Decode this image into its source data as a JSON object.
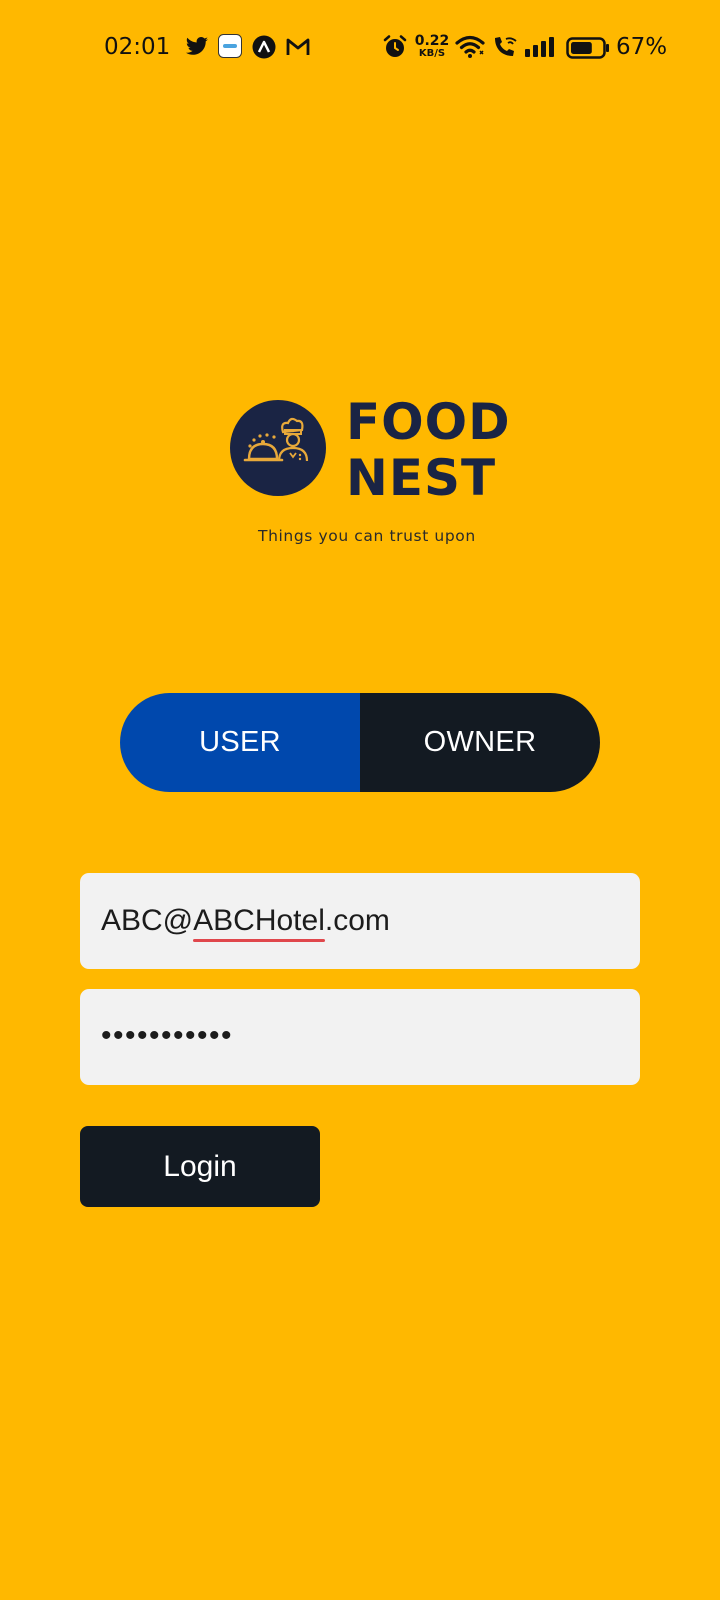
{
  "status_bar": {
    "time": "02:01",
    "net_speed_value": "0.22",
    "net_speed_unit": "KB/S",
    "battery_percent": "67%",
    "battery_level": 0.67,
    "icons": [
      "twitter-icon",
      "app-icon",
      "arc-icon",
      "gmail-icon",
      "alarm-icon",
      "wifi-icon",
      "wifi-call-icon",
      "signal-icon",
      "battery-icon"
    ]
  },
  "logo": {
    "line1": "FOOD",
    "line2": "NEST",
    "tagline": "Things you can trust upon",
    "brand_color": "#1a2444"
  },
  "role_toggle": {
    "options": [
      {
        "label": "USER",
        "selected": true
      },
      {
        "label": "OWNER",
        "selected": false
      }
    ],
    "selected_color": "#0048AD",
    "unselected_color": "#131A22"
  },
  "form": {
    "email_prefix": "ABC@",
    "email_underlined": "ABCHotel",
    "email_suffix": ".com",
    "password_masked": "•••••••••••",
    "login_label": "Login"
  },
  "colors": {
    "background": "#FFB800",
    "field_bg": "#F2F2F2"
  }
}
